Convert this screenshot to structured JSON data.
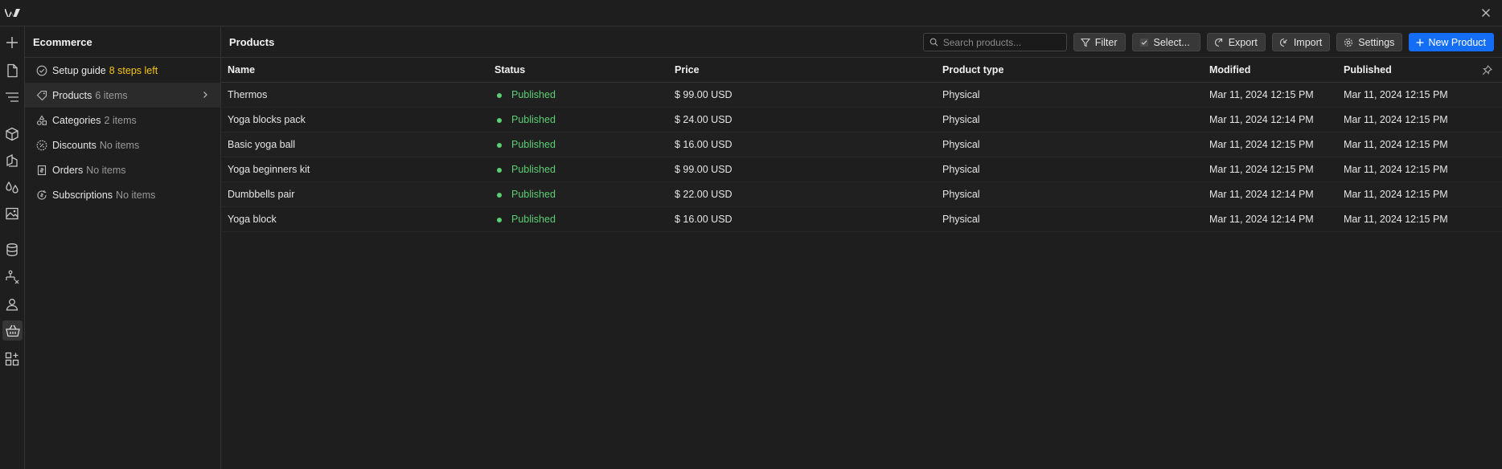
{
  "colors": {
    "accent": "#146ef5",
    "published": "#5ccf75",
    "warning": "#f5c518"
  },
  "icons": {
    "logo": "webflow-logo-icon",
    "close": "close-icon",
    "rail": [
      "plus-icon",
      "page-icon",
      "navigator-icon",
      "components-icon",
      "style-manager-icon",
      "variables-icon",
      "assets-icon",
      "cms-icon",
      "logic-icon",
      "users-icon",
      "ecommerce-icon",
      "apps-icon"
    ]
  },
  "sidebar": {
    "title": "Ecommerce",
    "items": [
      {
        "label": "Setup guide",
        "count": "8 steps left"
      },
      {
        "label": "Products",
        "count": "6 items"
      },
      {
        "label": "Categories",
        "count": "2 items"
      },
      {
        "label": "Discounts",
        "count": "No items"
      },
      {
        "label": "Orders",
        "count": "No items"
      },
      {
        "label": "Subscriptions",
        "count": "No items"
      }
    ]
  },
  "main": {
    "title": "Products",
    "search_placeholder": "Search products...",
    "buttons": {
      "filter": "Filter",
      "select": "Select...",
      "export": "Export",
      "import": "Import",
      "settings": "Settings",
      "new_product": "New Product"
    }
  },
  "table": {
    "columns": {
      "name": "Name",
      "status": "Status",
      "price": "Price",
      "type": "Product type",
      "modified": "Modified",
      "published": "Published"
    },
    "rows": [
      {
        "name": "Thermos",
        "status": "Published",
        "price": "$ 99.00 USD",
        "type": "Physical",
        "modified": "Mar 11, 2024 12:15 PM",
        "published": "Mar 11, 2024 12:15 PM"
      },
      {
        "name": "Yoga blocks pack",
        "status": "Published",
        "price": "$ 24.00 USD",
        "type": "Physical",
        "modified": "Mar 11, 2024 12:14 PM",
        "published": "Mar 11, 2024 12:15 PM"
      },
      {
        "name": "Basic yoga ball",
        "status": "Published",
        "price": "$ 16.00 USD",
        "type": "Physical",
        "modified": "Mar 11, 2024 12:15 PM",
        "published": "Mar 11, 2024 12:15 PM"
      },
      {
        "name": "Yoga beginners kit",
        "status": "Published",
        "price": "$ 99.00 USD",
        "type": "Physical",
        "modified": "Mar 11, 2024 12:15 PM",
        "published": "Mar 11, 2024 12:15 PM"
      },
      {
        "name": "Dumbbells pair",
        "status": "Published",
        "price": "$ 22.00 USD",
        "type": "Physical",
        "modified": "Mar 11, 2024 12:14 PM",
        "published": "Mar 11, 2024 12:15 PM"
      },
      {
        "name": "Yoga block",
        "status": "Published",
        "price": "$ 16.00 USD",
        "type": "Physical",
        "modified": "Mar 11, 2024 12:14 PM",
        "published": "Mar 11, 2024 12:15 PM"
      }
    ]
  }
}
